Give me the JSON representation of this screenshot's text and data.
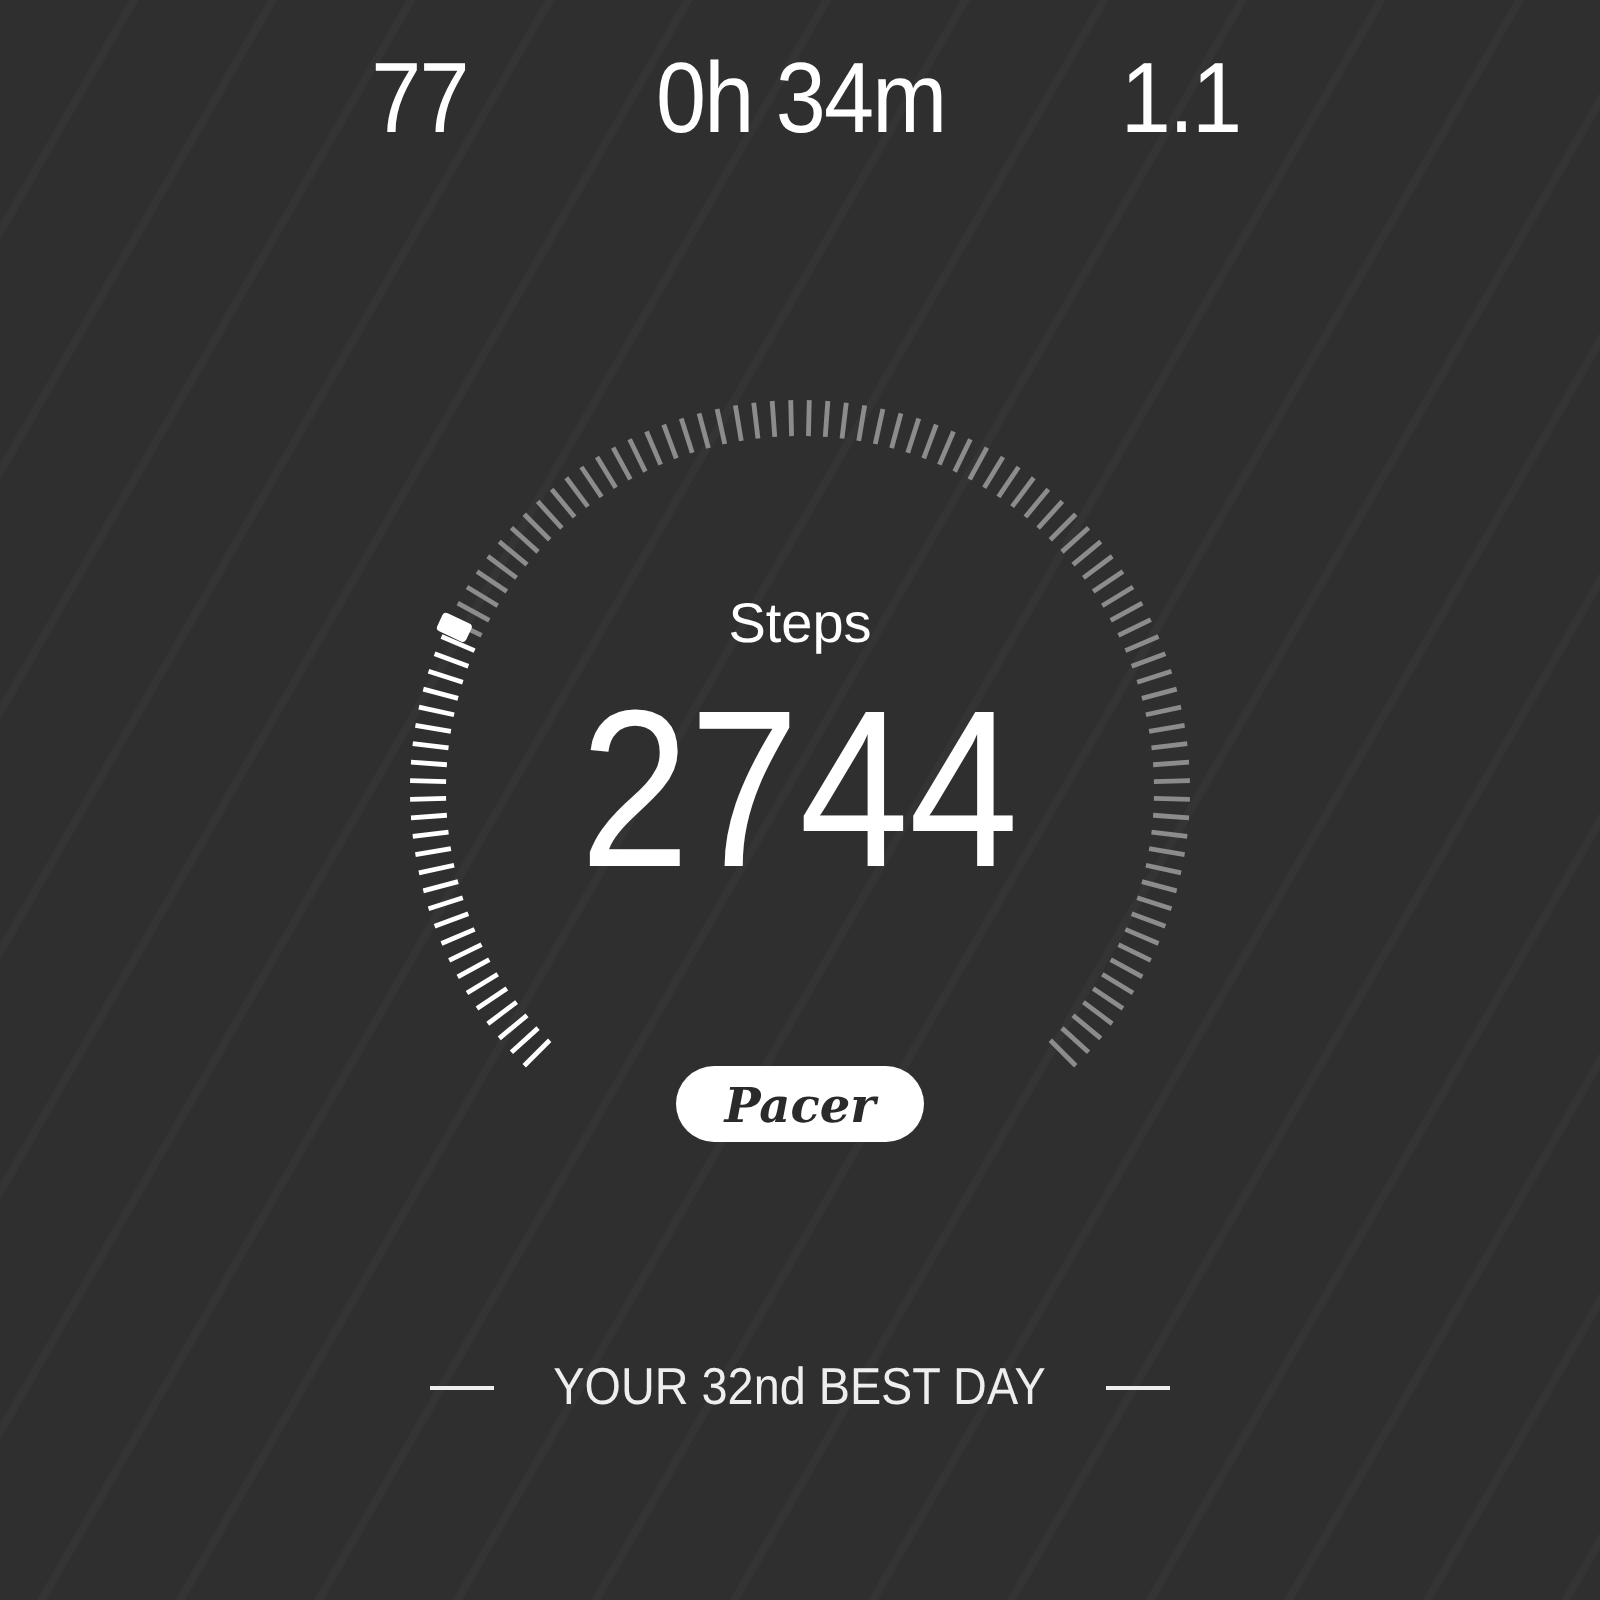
{
  "stats": [
    {
      "value": "77"
    },
    {
      "value": "0h 34m"
    },
    {
      "value": "1.1"
    }
  ],
  "gauge": {
    "label": "Steps",
    "value": "2744"
  },
  "logo": "Pacer",
  "footer": "YOUR 32nd BEST DAY"
}
